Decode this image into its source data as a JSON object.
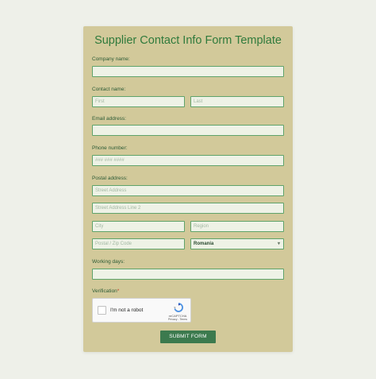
{
  "form": {
    "title": "Supplier Contact Info Form Template",
    "company": {
      "label": "Company name:",
      "value": ""
    },
    "contact": {
      "label": "Contact name:",
      "first_placeholder": "First",
      "last_placeholder": "Last"
    },
    "email": {
      "label": "Email address:",
      "value": ""
    },
    "phone": {
      "label": "Phone number:",
      "placeholder": "### ### ####"
    },
    "postal": {
      "label": "Postal address:",
      "street_placeholder": "Street Address",
      "street2_placeholder": "Street Address Line 2",
      "city_placeholder": "City",
      "region_placeholder": "Region",
      "zip_placeholder": "Postal / Zip Code",
      "country_value": "Romania"
    },
    "working_days": {
      "label": "Working days:",
      "value": ""
    },
    "verification": {
      "label": "Verification",
      "required_mark": "*",
      "captcha_text": "I'm not a robot",
      "captcha_brand": "reCAPTCHA",
      "captcha_links": "Privacy - Terms"
    },
    "submit_label": "SUBMIT FORM"
  },
  "colors": {
    "background": "#eef0e9",
    "card": "#d2c99a",
    "accent": "#2f7a3c",
    "button": "#3c7a4e",
    "field_border": "#5fa36a"
  }
}
